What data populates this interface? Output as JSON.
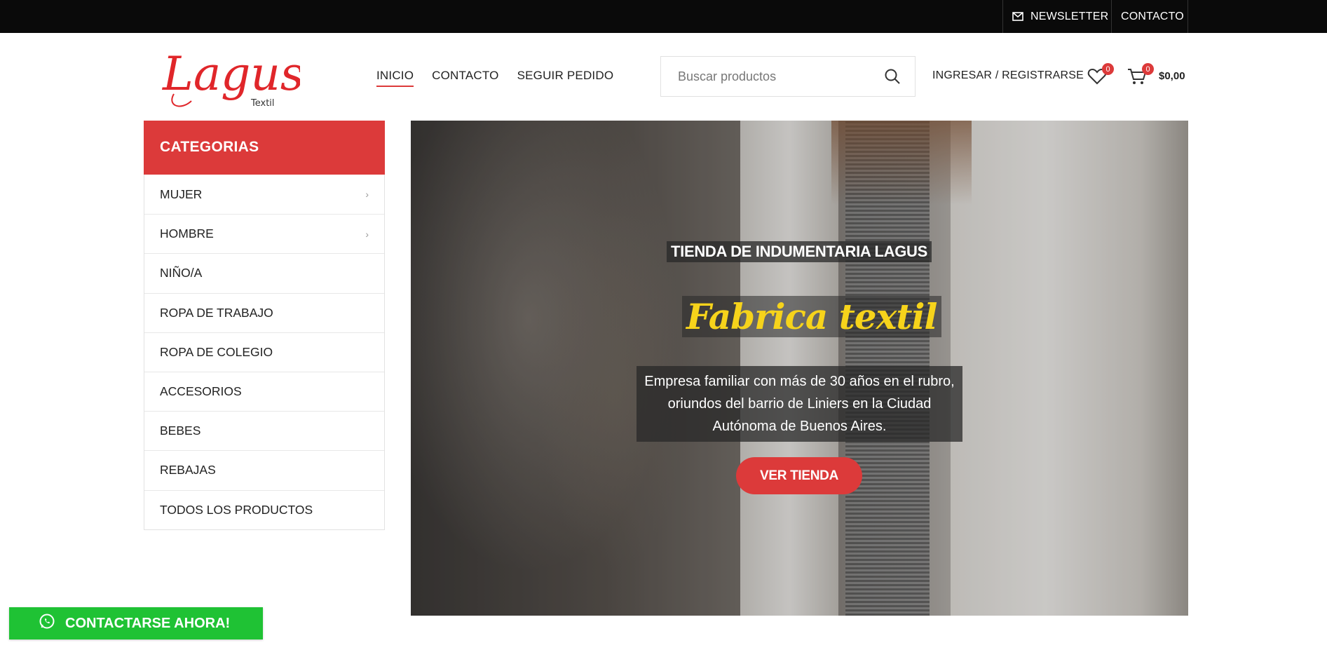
{
  "topbar": {
    "newsletter_label": "NEWSLETTER",
    "contact_label": "CONTACTO"
  },
  "logo": {
    "text": "Lagus",
    "subtext": "Textil",
    "color": "#e0262a"
  },
  "nav": {
    "items": [
      {
        "label": "INICIO",
        "active": true
      },
      {
        "label": "CONTACTO"
      },
      {
        "label": "SEGUIR PEDIDO"
      }
    ]
  },
  "search": {
    "placeholder": "Buscar productos"
  },
  "account": {
    "login_label": "INGRESAR / REGISTRARSE",
    "wishlist_count": "0",
    "cart_count": "0",
    "cart_total": "$0,00"
  },
  "sidebar": {
    "title": "CATEGORIAS",
    "items": [
      {
        "label": "MUJER",
        "has_children": true
      },
      {
        "label": "HOMBRE",
        "has_children": true
      },
      {
        "label": "NIÑO/A"
      },
      {
        "label": "ROPA DE TRABAJO"
      },
      {
        "label": "ROPA DE COLEGIO"
      },
      {
        "label": "ACCESORIOS"
      },
      {
        "label": "BEBES"
      },
      {
        "label": "REBAJAS"
      },
      {
        "label": "TODOS LOS PRODUCTOS"
      }
    ]
  },
  "hero": {
    "subtitle": "TIENDA DE INDUMENTARIA LAGUS",
    "title": "Fabrica textil",
    "description": "Empresa familiar con más de 30 años en el rubro, oriundos del barrio de Liniers en la Ciudad Autónoma de Buenos Aires.",
    "button_label": "VER TIENDA"
  },
  "whatsapp": {
    "label": "CONTACTARSE AHORA!"
  },
  "colors": {
    "accent": "#dc3a3a",
    "whatsapp": "#1fc234",
    "topbar": "#0a0a0a",
    "hero_title": "#f6d31b"
  }
}
